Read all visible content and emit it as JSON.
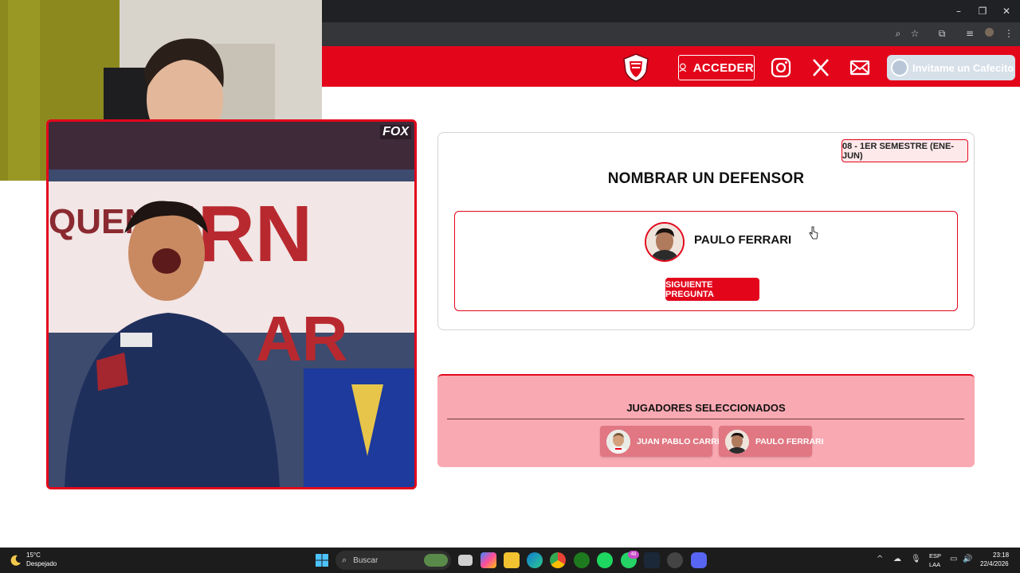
{
  "browser": {
    "window_controls": [
      "–",
      "❐",
      "✕"
    ],
    "toolbar_icons": [
      "zoom-icon",
      "star-icon",
      "extensions-icon",
      "media-icon",
      "profile-icon",
      "menu-icon"
    ]
  },
  "header": {
    "login_label": "ACCEDER",
    "cafecito_label": "Invitame un Cafecito",
    "brand_color": "#e3061b"
  },
  "video": {
    "overlay_logo": "FOX"
  },
  "question": {
    "semester": "08 - 1ER SEMESTRE (ENE-JUN)",
    "title": "NOMBRAR UN DEFENSOR",
    "answer_name": "PAULO FERRARI",
    "next_label": "SIGUIENTE PREGUNTA"
  },
  "selected": {
    "title": "JUGADORES SELECCIONADOS",
    "players": [
      "JUAN PABLO CARRIZO",
      "PAULO FERRARI"
    ]
  },
  "taskbar": {
    "temperature": "15°C",
    "weather": "Despejado",
    "search_placeholder": "Buscar",
    "notification_badge": "48",
    "lang_line1": "ESP",
    "lang_line2": "LAA",
    "time": "23:18",
    "date": "22/4/2026"
  }
}
